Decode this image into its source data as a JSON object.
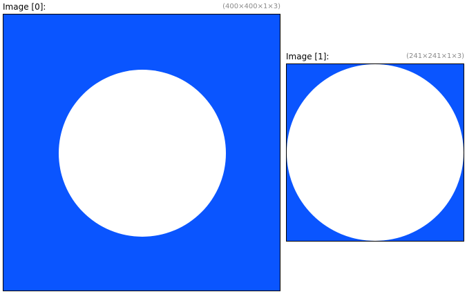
{
  "viewer": {
    "images": [
      {
        "title": "Image [0]:",
        "dimensions": "(400×400×1×3)",
        "background_color": "#0a55ff",
        "shape_color": "#ffffff",
        "shape": "circle"
      },
      {
        "title": "Image [1]:",
        "dimensions": "(241×241×1×3)",
        "background_color": "#0a55ff",
        "shape_color": "#ffffff",
        "shape": "circle"
      }
    ]
  }
}
